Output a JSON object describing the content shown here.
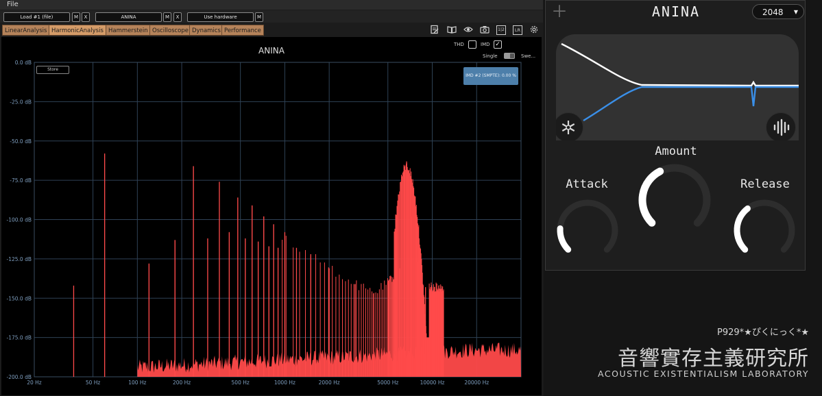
{
  "menu": {
    "file": "File"
  },
  "controls": {
    "load_label": "Load #1 (file)",
    "load_name": "ANINA",
    "hardware_label": "Use hardware",
    "m": "M",
    "x": "X"
  },
  "tabs": [
    "LinearAnalysis",
    "HarmonicAnalysis",
    "Hammerstein",
    "Oscilloscope",
    "Dynamics",
    "Performance"
  ],
  "active_tab": "HarmonicAnalysis",
  "toolbar_icons": [
    "notes-icon",
    "book-icon",
    "eye-icon",
    "camera-icon",
    "one-two-icon",
    "lr-icon",
    "gear-icon"
  ],
  "toolbar_text": {
    "one_two": "1|2",
    "lr": "LR"
  },
  "plot": {
    "title": "ANINA",
    "thd_label": "THD",
    "imd_label": "IMD",
    "imd_checked": true,
    "thd_checked": false,
    "single_label": "Single",
    "sweep_label": "Swe...",
    "store_label": "Store",
    "imd_readout": "IMD #2 (SMPTE): 0.00 %"
  },
  "chart_data": {
    "type": "line",
    "x_scale": "log",
    "xlim": [
      20,
      40000
    ],
    "ylim": [
      -200,
      0
    ],
    "y_ticks": [
      "0.0 dB",
      "-25.0 dB",
      "-50.0 dB",
      "-75.0 dB",
      "-100.0 dB",
      "-125.0 dB",
      "-150.0 dB",
      "-175.0 dB",
      "-200.0 dB"
    ],
    "x_ticks": [
      "20 Hz",
      "50 Hz",
      "100 Hz",
      "200 Hz",
      "500 Hz",
      "1000 Hz",
      "2000 Hz",
      "5000 Hz",
      "10000 Hz",
      "20000 Hz"
    ],
    "x_tick_values": [
      20,
      50,
      100,
      200,
      500,
      1000,
      2000,
      5000,
      10000,
      20000
    ],
    "grid": true,
    "line_color": "#ff4a4a",
    "background": "#000000",
    "fundamental_hz": 60,
    "peaks": [
      {
        "f": 37,
        "db": -142
      },
      {
        "f": 60,
        "db": -58
      },
      {
        "f": 120,
        "db": -128
      },
      {
        "f": 180,
        "db": -113
      },
      {
        "f": 240,
        "db": -66
      },
      {
        "f": 300,
        "db": -112
      },
      {
        "f": 360,
        "db": -76
      },
      {
        "f": 420,
        "db": -108
      },
      {
        "f": 480,
        "db": -86
      },
      {
        "f": 540,
        "db": -112
      },
      {
        "f": 600,
        "db": -91
      },
      {
        "f": 660,
        "db": -114
      },
      {
        "f": 720,
        "db": -98
      },
      {
        "f": 780,
        "db": -117
      },
      {
        "f": 840,
        "db": -103
      },
      {
        "f": 900,
        "db": -118
      },
      {
        "f": 1000,
        "db": -108
      },
      {
        "f": 1200,
        "db": -118
      },
      {
        "f": 1500,
        "db": -122
      },
      {
        "f": 2000,
        "db": -131
      },
      {
        "f": 3000,
        "db": -141
      },
      {
        "f": 4000,
        "db": -147
      },
      {
        "f": 5000,
        "db": -140
      },
      {
        "f": 6000,
        "db": -131
      },
      {
        "f": 6700,
        "db": -63
      },
      {
        "f": 7200,
        "db": -98
      },
      {
        "f": 8000,
        "db": -127
      },
      {
        "f": 9000,
        "db": -143
      }
    ],
    "noise_floor_db": -197,
    "noise_floor_high_db": -186
  },
  "plugin": {
    "name": "ANINA",
    "size_value": "2048",
    "size_arrow": "▼",
    "knobs": [
      {
        "label": "Attack",
        "value": 0.18
      },
      {
        "label": "Amount",
        "value": 0.4
      },
      {
        "label": "Release",
        "value": 0.36
      }
    ],
    "curve_colors": {
      "white": "#ffffff",
      "blue": "#3a8fe8"
    },
    "left_icon": "snowflake-icon",
    "right_icon": "waveform-icon"
  },
  "watermark": {
    "line1": "P929*★ぴくにっく*★",
    "line2": "音響實存主義研究所",
    "line3": "ACOUSTIC EXISTENTIALISM LABORATORY"
  }
}
